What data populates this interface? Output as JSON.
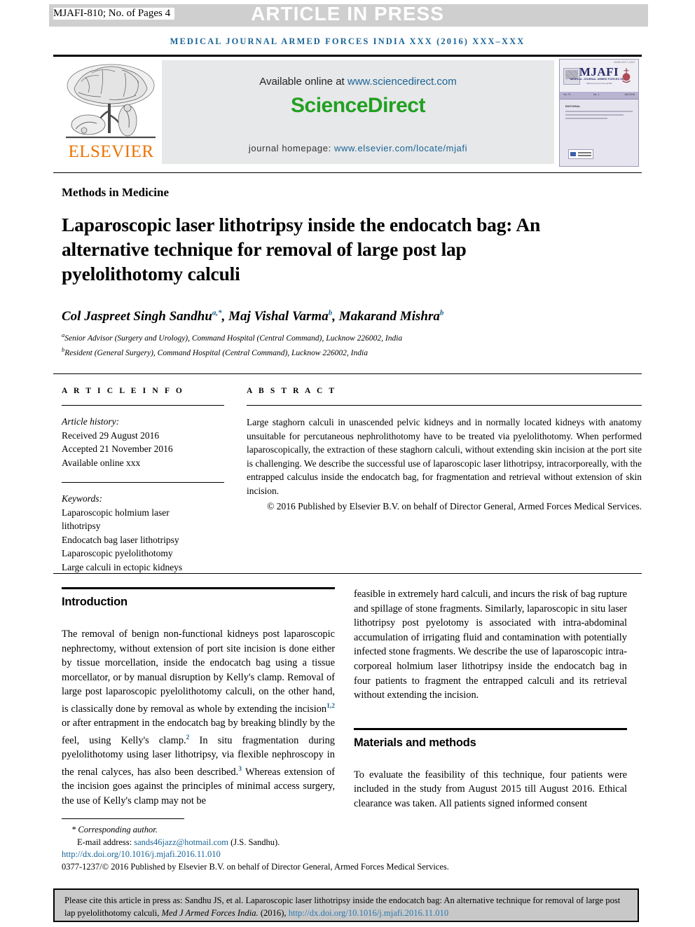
{
  "topbar": {
    "article_id": "MJAFI-810; No. of Pages 4",
    "banner": "ARTICLE IN PRESS",
    "journal_line": "MEDICAL JOURNAL ARMED FORCES INDIA XXX (2016) XXX–XXX",
    "banner_bg": "#cfcfcf",
    "journal_line_color": "#1a6496"
  },
  "masthead": {
    "elsevier_word": "ELSEVIER",
    "elsevier_color": "#ec7404",
    "available_prefix": "Available online at ",
    "available_url": "www.sciencedirect.com",
    "sciencedirect_logo": "ScienceDirect",
    "sciencedirect_color": "#22a022",
    "homepage_prefix": "journal homepage: ",
    "homepage_url": "www.elsevier.com/locate/mjafi",
    "cover": {
      "title": "MJAFI",
      "subtitle": "MEDICAL JOURNAL ARMED FORCES INDIA",
      "subtitle2": "Official journal of the AFMS",
      "issn": "ISSN 0377-1237",
      "vol": "Vol. 72",
      "issue": "No. 1",
      "date": "JAN 2016",
      "editorial": "EDITORIAL"
    }
  },
  "article": {
    "section_label": "Methods in Medicine",
    "title": "Laparoscopic laser lithotripsy inside the endocatch bag: An alternative technique for removal of large post lap pyelolithotomy calculi",
    "authors": [
      {
        "name": "Col Jaspreet Singh Sandhu",
        "marks": "a,*"
      },
      {
        "name": "Maj Vishal Varma",
        "marks": "b"
      },
      {
        "name": "Makarand Mishra",
        "marks": "b"
      }
    ],
    "affiliations": [
      {
        "mark": "a",
        "text": "Senior Advisor (Surgery and Urology), Command Hospital (Central Command), Lucknow 226002, India"
      },
      {
        "mark": "b",
        "text": "Resident (General Surgery), Command Hospital (Central Command), Lucknow 226002, India"
      }
    ]
  },
  "article_info": {
    "heading": "A R T I C L E  I N F O",
    "history_label": "Article history:",
    "received": "Received 29 August 2016",
    "accepted": "Accepted 21 November 2016",
    "available": "Available online xxx",
    "keywords_label": "Keywords:",
    "keywords": [
      "Laparoscopic holmium laser",
      "lithotripsy",
      "Endocatch bag laser lithotripsy",
      "Laparoscopic pyelolithotomy",
      "Large calculi in ectopic kidneys"
    ]
  },
  "abstract": {
    "heading": "A B S T R A C T",
    "text": "Large staghorn calculi in unascended pelvic kidneys and in normally located kidneys with anatomy unsuitable for percutaneous nephrolithotomy have to be treated via pyelolithotomy. When performed laparoscopically, the extraction of these staghorn calculi, without extending skin incision at the port site is challenging. We describe the successful use of laparoscopic laser lithotripsy, intracorporeally, with the entrapped calculus inside the endocatch bag, for fragmentation and retrieval without extension of skin incision.",
    "copyright": "© 2016 Published by Elsevier B.V. on behalf of Director General, Armed Forces Medical Services."
  },
  "body": {
    "left": {
      "section_title": "Introduction",
      "paragraph_pre": "The removal of benign non-functional kidneys post laparoscopic nephrectomy, without extension of port site incision is done either by tissue morcellation, inside the endocatch bag using a tissue morcellator, or by manual disruption by Kelly's clamp. Removal of large post laparoscopic pyelolithotomy calculi, on the other hand, is classically done by removal as whole by extending the incision",
      "cite1": "1,2",
      "paragraph_mid": " or after entrapment in the endocatch bag by breaking blindly by the feel, using Kelly's clamp.",
      "cite2": "2",
      "paragraph_mid2": " In situ fragmentation during pyelolithotomy using laser lithotripsy, via flexible nephroscopy in the renal calyces, has also been described.",
      "cite3": "3",
      "paragraph_end": " Whereas extension of the incision goes against the principles of minimal access surgery, the use of Kelly's clamp may not be"
    },
    "right": {
      "continued": "feasible in extremely hard calculi, and incurs the risk of bag rupture and spillage of stone fragments. Similarly, laparoscopic in situ laser lithotripsy post pyelotomy is associated with intra-abdominal accumulation of irrigating fluid and contamination with potentially infected stone fragments. We describe the use of laparoscopic intra-corporeal holmium laser lithotripsy inside the endocatch bag in four patients to fragment the entrapped calculi and its retrieval without extending the incision.",
      "section_title": "Materials and methods",
      "paragraph": "To evaluate the feasibility of this technique, four patients were included in the study from August 2015 till August 2016. Ethical clearance was taken. All patients signed informed consent"
    }
  },
  "footnote": {
    "corresponding": "* Corresponding author.",
    "email_label": "E-mail address: ",
    "email": "sands46jazz@hotmail.com",
    "email_suffix": " (J.S. Sandhu).",
    "doi": "http://dx.doi.org/10.1016/j.mjafi.2016.11.010",
    "copyright": "0377-1237/© 2016 Published by Elsevier B.V. on behalf of Director General, Armed Forces Medical Services.",
    "link_color": "#1a6496"
  },
  "citation_box": {
    "prefix": "Please cite this article in press as: Sandhu JS, et al. Laparoscopic laser lithotripsy inside the endocatch bag: An alternative technique for removal of large post lap pyelolithotomy calculi, ",
    "journal": "Med J Armed Forces India.",
    "middle": " (2016), ",
    "doi": "http://dx.doi.org/10.1016/j.mjafi.2016.11.010",
    "bg": "#c8c8c8"
  }
}
